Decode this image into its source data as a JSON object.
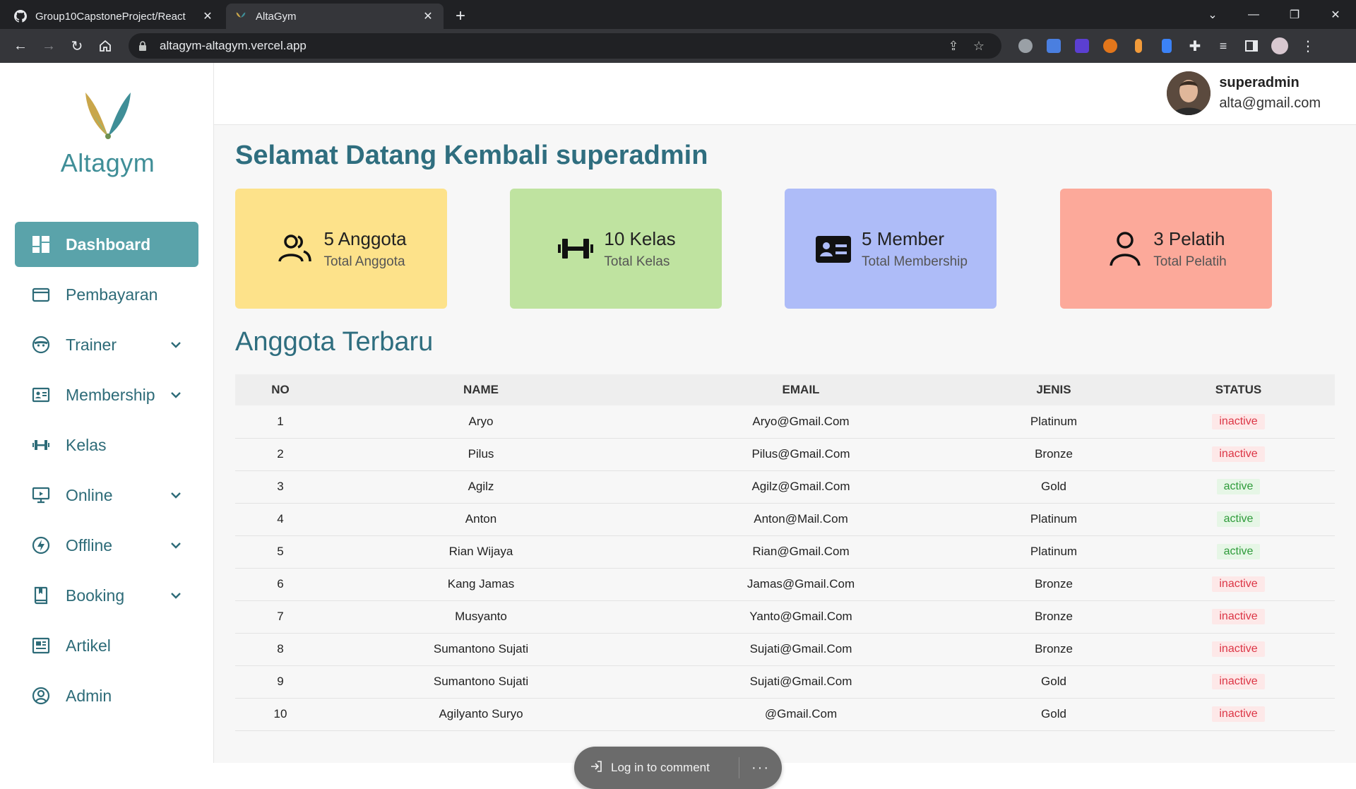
{
  "browser": {
    "tabs": [
      {
        "title": "Group10CapstoneProject/React",
        "icon": "github-icon",
        "active": false
      },
      {
        "title": "AltaGym",
        "icon": "altagym-favicon",
        "active": true
      }
    ],
    "new_tab_label": "+",
    "url": "altagym-altagym.vercel.app"
  },
  "app": {
    "logo_text": "Altagym",
    "menu": [
      {
        "label": "Dashboard",
        "icon": "dashboard-icon",
        "active": true,
        "expandable": false
      },
      {
        "label": "Pembayaran",
        "icon": "wallet-icon",
        "active": false,
        "expandable": false
      },
      {
        "label": "Trainer",
        "icon": "face-icon",
        "active": false,
        "expandable": true
      },
      {
        "label": "Membership",
        "icon": "id-card-icon",
        "active": false,
        "expandable": true
      },
      {
        "label": "Kelas",
        "icon": "dumbbell-icon",
        "active": false,
        "expandable": false
      },
      {
        "label": "Online",
        "icon": "monitor-icon",
        "active": false,
        "expandable": true
      },
      {
        "label": "Offline",
        "icon": "bolt-icon",
        "active": false,
        "expandable": true
      },
      {
        "label": "Booking",
        "icon": "book-icon",
        "active": false,
        "expandable": true
      },
      {
        "label": "Artikel",
        "icon": "newspaper-icon",
        "active": false,
        "expandable": false
      },
      {
        "label": "Admin",
        "icon": "user-circle-icon",
        "active": false,
        "expandable": false
      }
    ],
    "user": {
      "name": "superadmin",
      "email": "alta@gmail.com"
    },
    "welcome": "Selamat Datang Kembali superadmin",
    "cards": [
      {
        "value": "5 Anggota",
        "label": "Total Anggota",
        "color": "#fde28a",
        "icon": "users-icon"
      },
      {
        "value": "10 Kelas",
        "label": "Total Kelas",
        "color": "#bfe3a0",
        "icon": "dumbbell-icon"
      },
      {
        "value": "5 Member",
        "label": "Total Membership",
        "color": "#aebcf8",
        "icon": "id-card-icon"
      },
      {
        "value": "3 Pelatih",
        "label": "Total Pelatih",
        "color": "#fca99a",
        "icon": "user-icon"
      }
    ],
    "section_title": "Anggota Terbaru",
    "table": {
      "headers": [
        "NO",
        "NAME",
        "EMAIL",
        "JENIS",
        "STATUS"
      ],
      "rows": [
        {
          "no": "1",
          "name": "Aryo",
          "email": "Aryo@Gmail.Com",
          "jenis": "Platinum",
          "status": "inactive"
        },
        {
          "no": "2",
          "name": "Pilus",
          "email": "Pilus@Gmail.Com",
          "jenis": "Bronze",
          "status": "inactive"
        },
        {
          "no": "3",
          "name": "Agilz",
          "email": "Agilz@Gmail.Com",
          "jenis": "Gold",
          "status": "active"
        },
        {
          "no": "4",
          "name": "Anton",
          "email": "Anton@Mail.Com",
          "jenis": "Platinum",
          "status": "active"
        },
        {
          "no": "5",
          "name": "Rian Wijaya",
          "email": "Rian@Gmail.Com",
          "jenis": "Platinum",
          "status": "active"
        },
        {
          "no": "6",
          "name": "Kang Jamas",
          "email": "Jamas@Gmail.Com",
          "jenis": "Bronze",
          "status": "inactive"
        },
        {
          "no": "7",
          "name": "Musyanto",
          "email": "Yanto@Gmail.Com",
          "jenis": "Bronze",
          "status": "inactive"
        },
        {
          "no": "8",
          "name": "Sumantono Sujati",
          "email": "Sujati@Gmail.Com",
          "jenis": "Bronze",
          "status": "inactive"
        },
        {
          "no": "9",
          "name": "Sumantono Sujati",
          "email": "Sujati@Gmail.Com",
          "jenis": "Gold",
          "status": "inactive"
        },
        {
          "no": "10",
          "name": "Agilyanto Suryo",
          "email": "@Gmail.Com",
          "jenis": "Gold",
          "status": "inactive"
        }
      ]
    },
    "comment_pill": {
      "label": "Log in to comment",
      "more": "···"
    }
  },
  "colors": {
    "accent": "#5aa3aa",
    "heading": "#2f6e7f",
    "sidebar_text": "#2d6b78"
  }
}
